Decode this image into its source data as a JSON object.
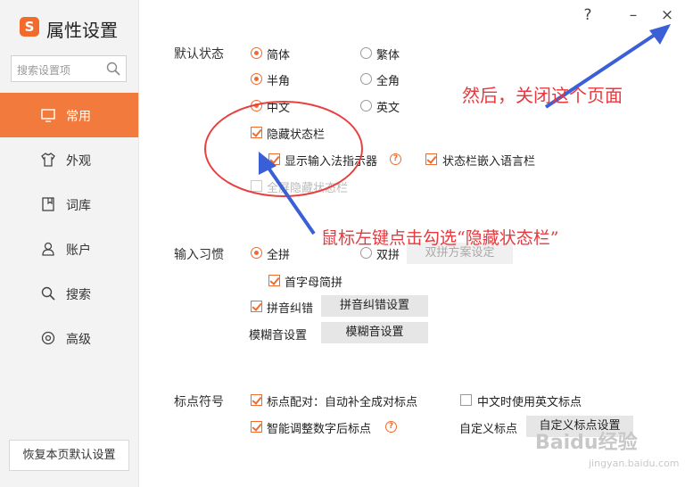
{
  "app": {
    "logo_glyph": "S",
    "title": "属性设置"
  },
  "window": {
    "help": "?",
    "minimize": "–",
    "close": "×"
  },
  "search": {
    "placeholder": "搜索设置项"
  },
  "sidebar": {
    "items": [
      {
        "label": "常用",
        "icon": "monitor-icon",
        "active": true
      },
      {
        "label": "外观",
        "icon": "shirt-icon"
      },
      {
        "label": "词库",
        "icon": "book-icon"
      },
      {
        "label": "账户",
        "icon": "user-icon"
      },
      {
        "label": "搜索",
        "icon": "search-icon"
      },
      {
        "label": "高级",
        "icon": "gear-icon"
      }
    ],
    "reset_label": "恢复本页默认设置"
  },
  "default_state": {
    "label": "默认状态",
    "simplified": "简体",
    "traditional": "繁体",
    "halfwidth": "半角",
    "fullwidth": "全角",
    "chinese": "中文",
    "english": "英文",
    "hide_status_bar": "隐藏状态栏",
    "show_ime_indicator": "显示输入法指示器",
    "embed_language_bar": "状态栏嵌入语言栏",
    "fullscreen_hide": "全屏隐藏状态栏"
  },
  "input_habits": {
    "label": "输入习惯",
    "full_pinyin": "全拼",
    "double_pinyin": "双拼",
    "double_scheme_btn": "双拼方案设定",
    "initial_jianpin": "首字母简拼",
    "pinyin_correction": "拼音纠错",
    "pinyin_correction_btn": "拼音纠错设置",
    "fuzzy_label": "模糊音设置",
    "fuzzy_btn": "模糊音设置"
  },
  "punctuation": {
    "label": "标点符号",
    "auto_pair": "标点配对：自动补全成对标点",
    "english_in_chinese": "中文时使用英文标点",
    "smart_digit": "智能调整数字后标点",
    "custom_label": "自定义标点",
    "custom_btn": "自定义标点设置"
  },
  "annotations": {
    "close_hint": "然后，关闭这个页面",
    "click_hint": "鼠标左键点击勾选“隐藏状态栏”"
  },
  "watermark": {
    "brand": "Baidu经验",
    "url": "jingyan.baidu.com"
  },
  "colors": {
    "accent": "#f26b2b",
    "annotation": "#e8383d",
    "arrow": "#3a5fd6"
  }
}
